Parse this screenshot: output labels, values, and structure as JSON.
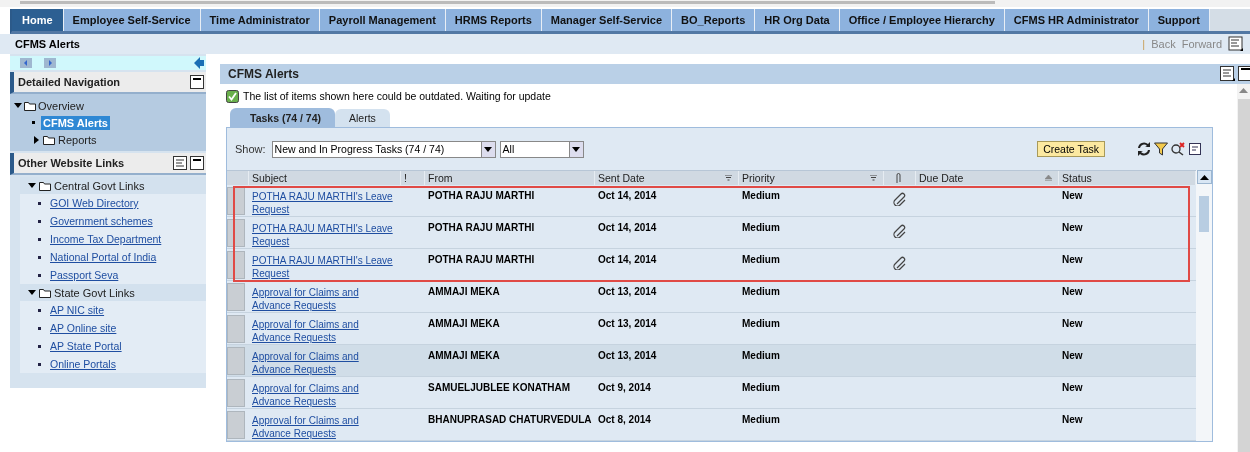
{
  "top_nav": [
    {
      "label": "Home",
      "selected": true
    },
    {
      "label": "Employee Self-Service",
      "selected": false
    },
    {
      "label": "Time Administrator",
      "selected": false
    },
    {
      "label": "Payroll Management",
      "selected": false
    },
    {
      "label": "HRMS Reports",
      "selected": false
    },
    {
      "label": "Manager Self-Service",
      "selected": false
    },
    {
      "label": "BO_Reports",
      "selected": false
    },
    {
      "label": "HR Org Data",
      "selected": false
    },
    {
      "label": "Office / Employee Hierarchy",
      "selected": false
    },
    {
      "label": "CFMS HR Administrator",
      "selected": false
    },
    {
      "label": "Support",
      "selected": false
    }
  ],
  "page_title": "CFMS Alerts",
  "history": {
    "separator": "|",
    "back": "Back",
    "forward": "Forward"
  },
  "sidebar": {
    "detailed_navigation": {
      "title": "Detailed Navigation",
      "items": [
        {
          "label": "Overview",
          "expanded": true,
          "children": [
            {
              "label": "CFMS Alerts",
              "selected": true
            },
            {
              "label": "Reports",
              "expanded": false,
              "selected": false
            }
          ]
        }
      ]
    },
    "other_links": {
      "title": "Other Website Links",
      "groups": [
        {
          "label": "Central Govt Links",
          "expanded": true,
          "links": [
            "GOI Web Directory",
            "Government schemes",
            "Income Tax Department",
            "National Portal of India",
            "Passport Seva"
          ]
        },
        {
          "label": "State Govt Links",
          "expanded": true,
          "links": [
            "AP NIC site",
            "AP Online site",
            "AP State Portal",
            "Online Portals"
          ]
        }
      ]
    }
  },
  "main": {
    "title": "CFMS Alerts",
    "notice": {
      "checked": true,
      "text": "The list of items shown here could be outdated. Waiting for update"
    },
    "tabs": [
      {
        "label": "Tasks  (74 / 74)",
        "selected": true
      },
      {
        "label": "Alerts",
        "selected": false
      }
    ],
    "show_label": "Show:",
    "show_filter": "New and In Progress Tasks  (74 / 74)",
    "second_filter": "All",
    "create_button": "Create Task",
    "table": {
      "columns": [
        "Subject",
        "!",
        "From",
        "Sent Date",
        "Priority",
        "",
        "Due Date",
        "Status"
      ],
      "rows": [
        {
          "subject": "POTHA RAJU MARTHI's Leave Request",
          "from": "POTHA RAJU MARTHI",
          "sent": "Oct 14, 2014",
          "priority": "Medium",
          "attachment": true,
          "status": "New",
          "highlighted": true
        },
        {
          "subject": "POTHA RAJU MARTHI's Leave Request",
          "from": "POTHA RAJU MARTHI",
          "sent": "Oct 14, 2014",
          "priority": "Medium",
          "attachment": true,
          "status": "New",
          "highlighted": true
        },
        {
          "subject": "POTHA RAJU MARTHI's Leave Request",
          "from": "POTHA RAJU MARTHI",
          "sent": "Oct 14, 2014",
          "priority": "Medium",
          "attachment": true,
          "status": "New",
          "highlighted": true
        },
        {
          "subject": "Approval for Claims and Advance Requests",
          "from": "AMMAJI MEKA",
          "sent": "Oct 13, 2014",
          "priority": "Medium",
          "attachment": false,
          "status": "New",
          "highlighted": false
        },
        {
          "subject": "Approval for Claims and Advance Requests",
          "from": "AMMAJI MEKA",
          "sent": "Oct 13, 2014",
          "priority": "Medium",
          "attachment": false,
          "status": "New",
          "highlighted": false
        },
        {
          "subject": "Approval for Claims and Advance Requests",
          "from": "AMMAJI MEKA",
          "sent": "Oct 13, 2014",
          "priority": "Medium",
          "attachment": false,
          "status": "New",
          "highlighted": false
        },
        {
          "subject": "Approval for Claims and Advance Requests",
          "from": "SAMUELJUBLEE KONATHAM",
          "sent": "Oct 9, 2014",
          "priority": "Medium",
          "attachment": false,
          "status": "New",
          "highlighted": false
        },
        {
          "subject": "Approval for Claims and Advance Requests",
          "from": "BHANUPRASAD CHATURVEDULA",
          "sent": "Oct 8, 2014",
          "priority": "Medium",
          "attachment": false,
          "status": "New",
          "highlighted": false
        }
      ]
    }
  }
}
